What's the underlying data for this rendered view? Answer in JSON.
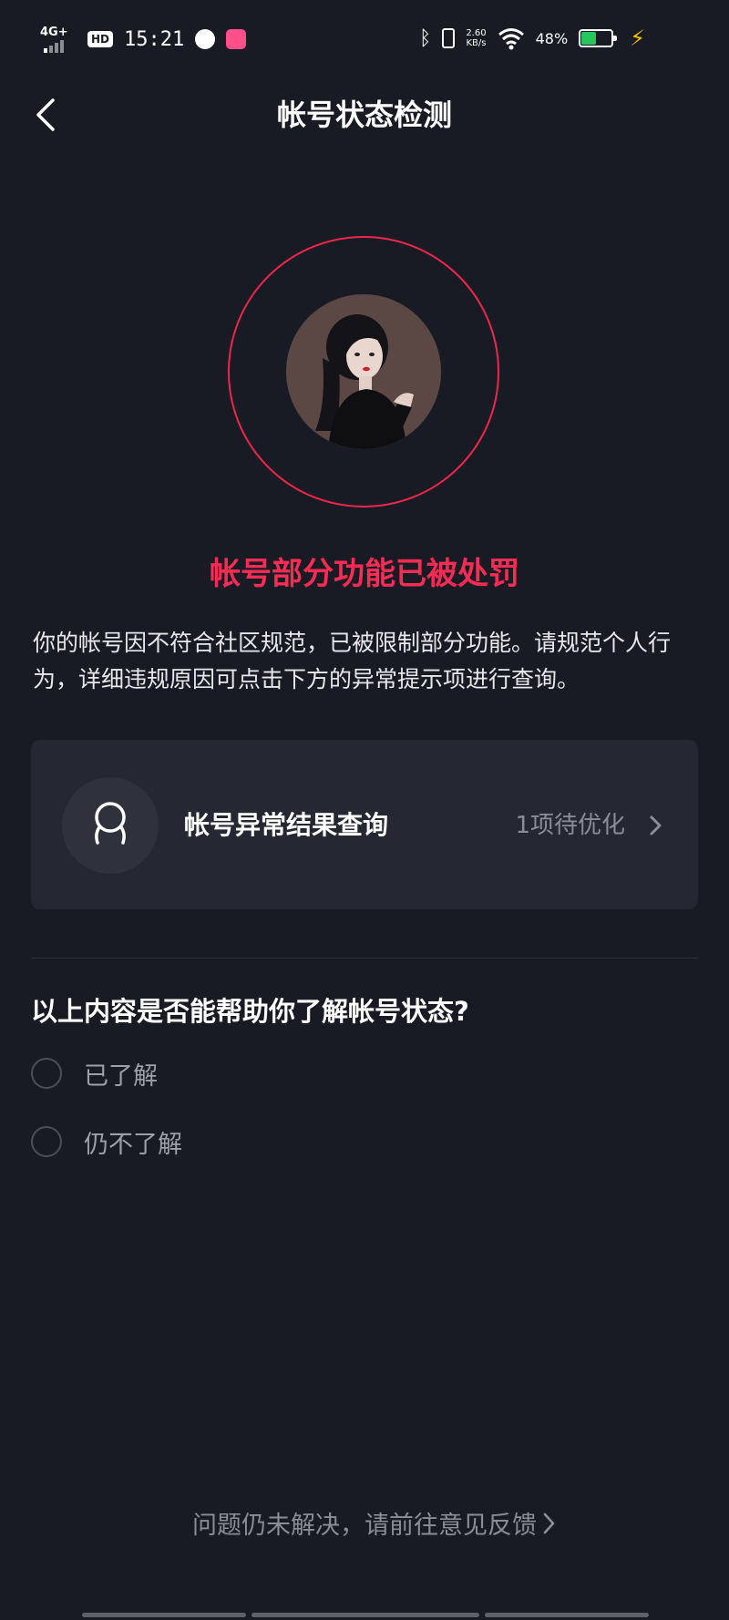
{
  "status_bar": {
    "network": "4G+",
    "hd": "HD",
    "time": "15:21",
    "net_speed_value": "2.60",
    "net_speed_unit": "KB/s",
    "battery_percent": "48%",
    "battery_level": 0.48
  },
  "header": {
    "title": "帐号状态检测"
  },
  "penalty": {
    "title": "帐号部分功能已被处罚",
    "description": "你的帐号因不符合社区规范，已被限制部分功能。请规范个人行为，详细违规原因可点击下方的异常提示项进行查询。"
  },
  "query_card": {
    "label": "帐号异常结果查询",
    "status": "1项待优化"
  },
  "survey": {
    "question": "以上内容是否能帮助你了解帐号状态?",
    "options": [
      {
        "label": "已了解"
      },
      {
        "label": "仍不了解"
      }
    ]
  },
  "footer": {
    "feedback_link": "问题仍未解决，请前往意见反馈"
  },
  "colors": {
    "background": "#181b24",
    "accent": "#fe2c55",
    "card": "#252833",
    "muted_text": "#8a8d97"
  },
  "icons": {
    "back": "back-arrow-icon",
    "card": "person-outline-icon",
    "chevron": "chevron-right-icon",
    "feedback_chevron": "chevron-right-icon"
  }
}
